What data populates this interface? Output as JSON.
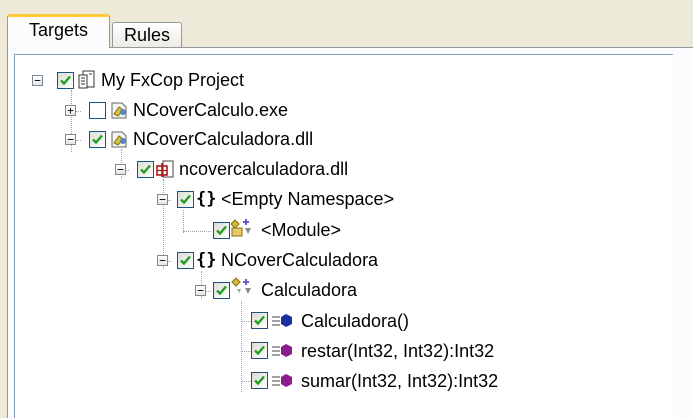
{
  "tabs": [
    {
      "label": "Targets",
      "active": true
    },
    {
      "label": "Rules",
      "active": false
    }
  ],
  "tree": {
    "nodes": [
      {
        "label": "My FxCop Project",
        "icon": "project-icon",
        "checked": true,
        "expanded": true
      },
      {
        "label": "NCoverCalculo.exe",
        "icon": "assembly-icon",
        "checked": false,
        "expanded": false
      },
      {
        "label": "NCoverCalculadora.dll",
        "icon": "assembly-icon",
        "checked": true,
        "expanded": true
      },
      {
        "label": "ncovercalculadora.dll",
        "icon": "module-file-icon",
        "checked": true,
        "expanded": true
      },
      {
        "label": "<Empty Namespace>",
        "icon": "namespace-icon",
        "checked": true,
        "expanded": true
      },
      {
        "label": "<Module>",
        "icon": "module-class-icon",
        "checked": true
      },
      {
        "label": "NCoverCalculadora",
        "icon": "namespace-icon",
        "checked": true,
        "expanded": true
      },
      {
        "label": "Calculadora",
        "icon": "class-icon",
        "checked": true,
        "expanded": true
      },
      {
        "label": "Calculadora()",
        "icon": "constructor-icon",
        "checked": true
      },
      {
        "label": "restar(Int32, Int32):Int32",
        "icon": "method-icon",
        "checked": true
      },
      {
        "label": "sumar(Int32, Int32):Int32",
        "icon": "method-icon",
        "checked": true
      }
    ]
  },
  "colors": {
    "tab_highlight": "#ffc83c",
    "check": "#21a121",
    "method": "#8b1e8b",
    "constructor": "#1a2fa0"
  }
}
